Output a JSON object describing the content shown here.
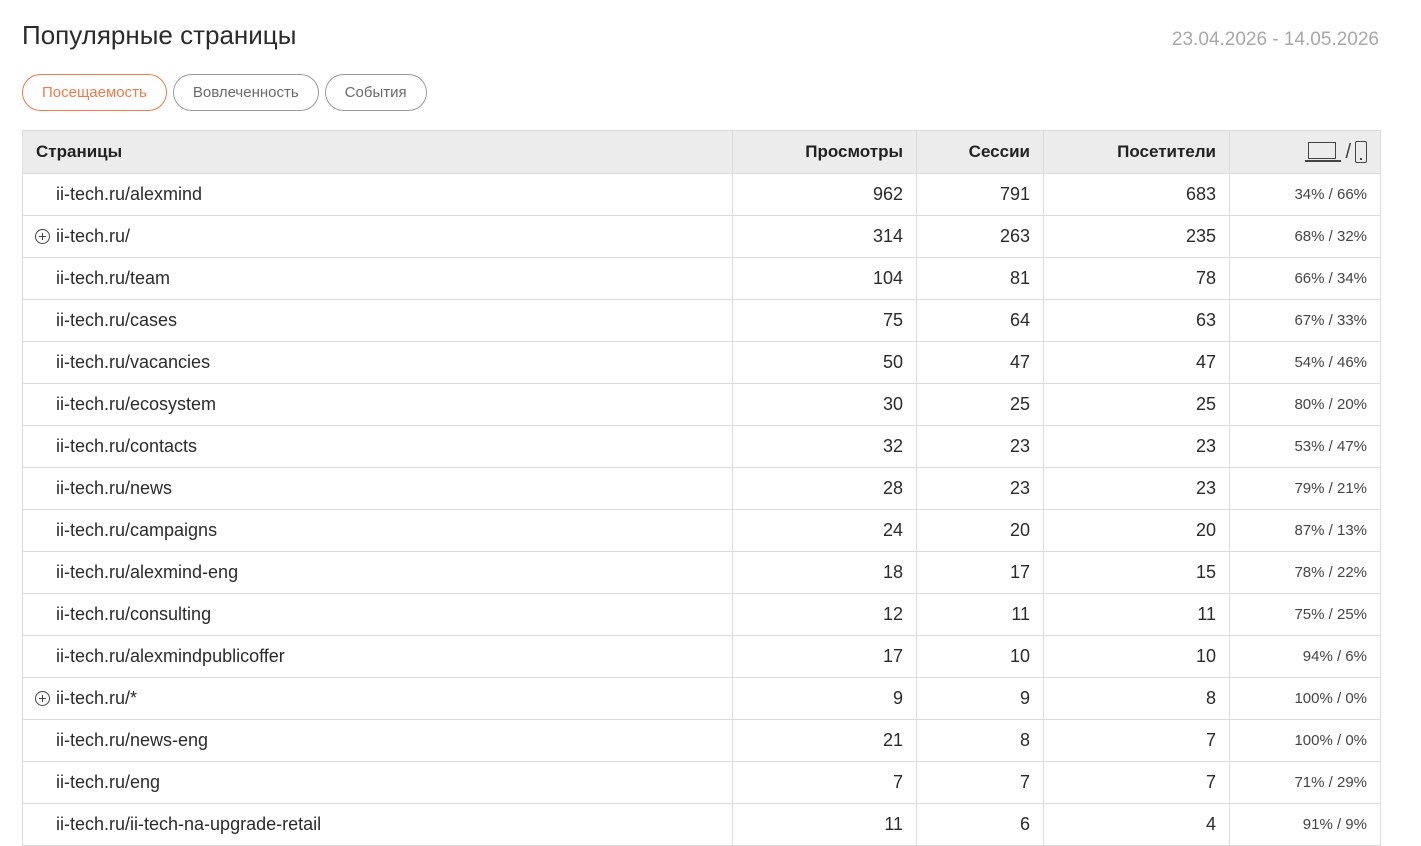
{
  "header": {
    "title": "Популярные страницы",
    "date_range": "23.04.2026 - 14.05.2026"
  },
  "tabs": [
    {
      "label": "Посещаемость",
      "active": true
    },
    {
      "label": "Вовлеченность",
      "active": false
    },
    {
      "label": "События",
      "active": false
    }
  ],
  "table": {
    "columns": {
      "page": "Страницы",
      "views": "Просмотры",
      "sessions": "Сессии",
      "visitors": "Посетители",
      "devices_icons": [
        "laptop-icon",
        "phone-icon"
      ],
      "devices_separator": "/"
    },
    "rows": [
      {
        "page": "ii-tech.ru/alexmind",
        "expandable": false,
        "views": "962",
        "sessions": "791",
        "visitors": "683",
        "devices": "34% / 66%"
      },
      {
        "page": "ii-tech.ru/",
        "expandable": true,
        "views": "314",
        "sessions": "263",
        "visitors": "235",
        "devices": "68% / 32%"
      },
      {
        "page": "ii-tech.ru/team",
        "expandable": false,
        "views": "104",
        "sessions": "81",
        "visitors": "78",
        "devices": "66% / 34%"
      },
      {
        "page": "ii-tech.ru/cases",
        "expandable": false,
        "views": "75",
        "sessions": "64",
        "visitors": "63",
        "devices": "67% / 33%"
      },
      {
        "page": "ii-tech.ru/vacancies",
        "expandable": false,
        "views": "50",
        "sessions": "47",
        "visitors": "47",
        "devices": "54% / 46%"
      },
      {
        "page": "ii-tech.ru/ecosystem",
        "expandable": false,
        "views": "30",
        "sessions": "25",
        "visitors": "25",
        "devices": "80% / 20%"
      },
      {
        "page": "ii-tech.ru/contacts",
        "expandable": false,
        "views": "32",
        "sessions": "23",
        "visitors": "23",
        "devices": "53% / 47%"
      },
      {
        "page": "ii-tech.ru/news",
        "expandable": false,
        "views": "28",
        "sessions": "23",
        "visitors": "23",
        "devices": "79% / 21%"
      },
      {
        "page": "ii-tech.ru/campaigns",
        "expandable": false,
        "views": "24",
        "sessions": "20",
        "visitors": "20",
        "devices": "87% / 13%"
      },
      {
        "page": "ii-tech.ru/alexmind-eng",
        "expandable": false,
        "views": "18",
        "sessions": "17",
        "visitors": "15",
        "devices": "78% / 22%"
      },
      {
        "page": "ii-tech.ru/consulting",
        "expandable": false,
        "views": "12",
        "sessions": "11",
        "visitors": "11",
        "devices": "75% / 25%"
      },
      {
        "page": "ii-tech.ru/alexmindpublicoffer",
        "expandable": false,
        "views": "17",
        "sessions": "10",
        "visitors": "10",
        "devices": "94% / 6%"
      },
      {
        "page": "ii-tech.ru/*",
        "expandable": true,
        "views": "9",
        "sessions": "9",
        "visitors": "8",
        "devices": "100% / 0%"
      },
      {
        "page": "ii-tech.ru/news-eng",
        "expandable": false,
        "views": "21",
        "sessions": "8",
        "visitors": "7",
        "devices": "100% / 0%"
      },
      {
        "page": "ii-tech.ru/eng",
        "expandable": false,
        "views": "7",
        "sessions": "7",
        "visitors": "7",
        "devices": "71% / 29%"
      },
      {
        "page": "ii-tech.ru/ii-tech-na-upgrade-retail",
        "expandable": false,
        "views": "11",
        "sessions": "6",
        "visitors": "4",
        "devices": "91% / 9%"
      }
    ]
  }
}
